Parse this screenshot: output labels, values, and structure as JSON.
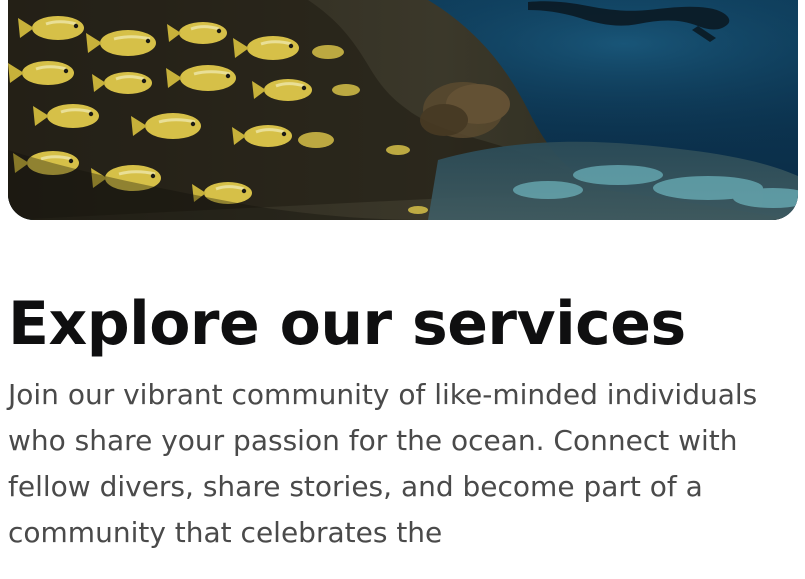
{
  "hero": {
    "image_alt": "",
    "palette": {
      "water_top": "#0d3c5a",
      "water_mid": "#0a2b45",
      "reef_dark": "#1b1a15",
      "reef_light": "#4c4a3a",
      "fish_yellow": "#d6c048",
      "fish_stripe": "#e9df96",
      "seabed_cyan": "#7fd2db"
    }
  },
  "content": {
    "title": "Explore our services",
    "description": "Join our vibrant community of like-minded individuals who share your passion for the ocean. Connect with fellow divers, share stories, and become part of a community that celebrates the"
  }
}
